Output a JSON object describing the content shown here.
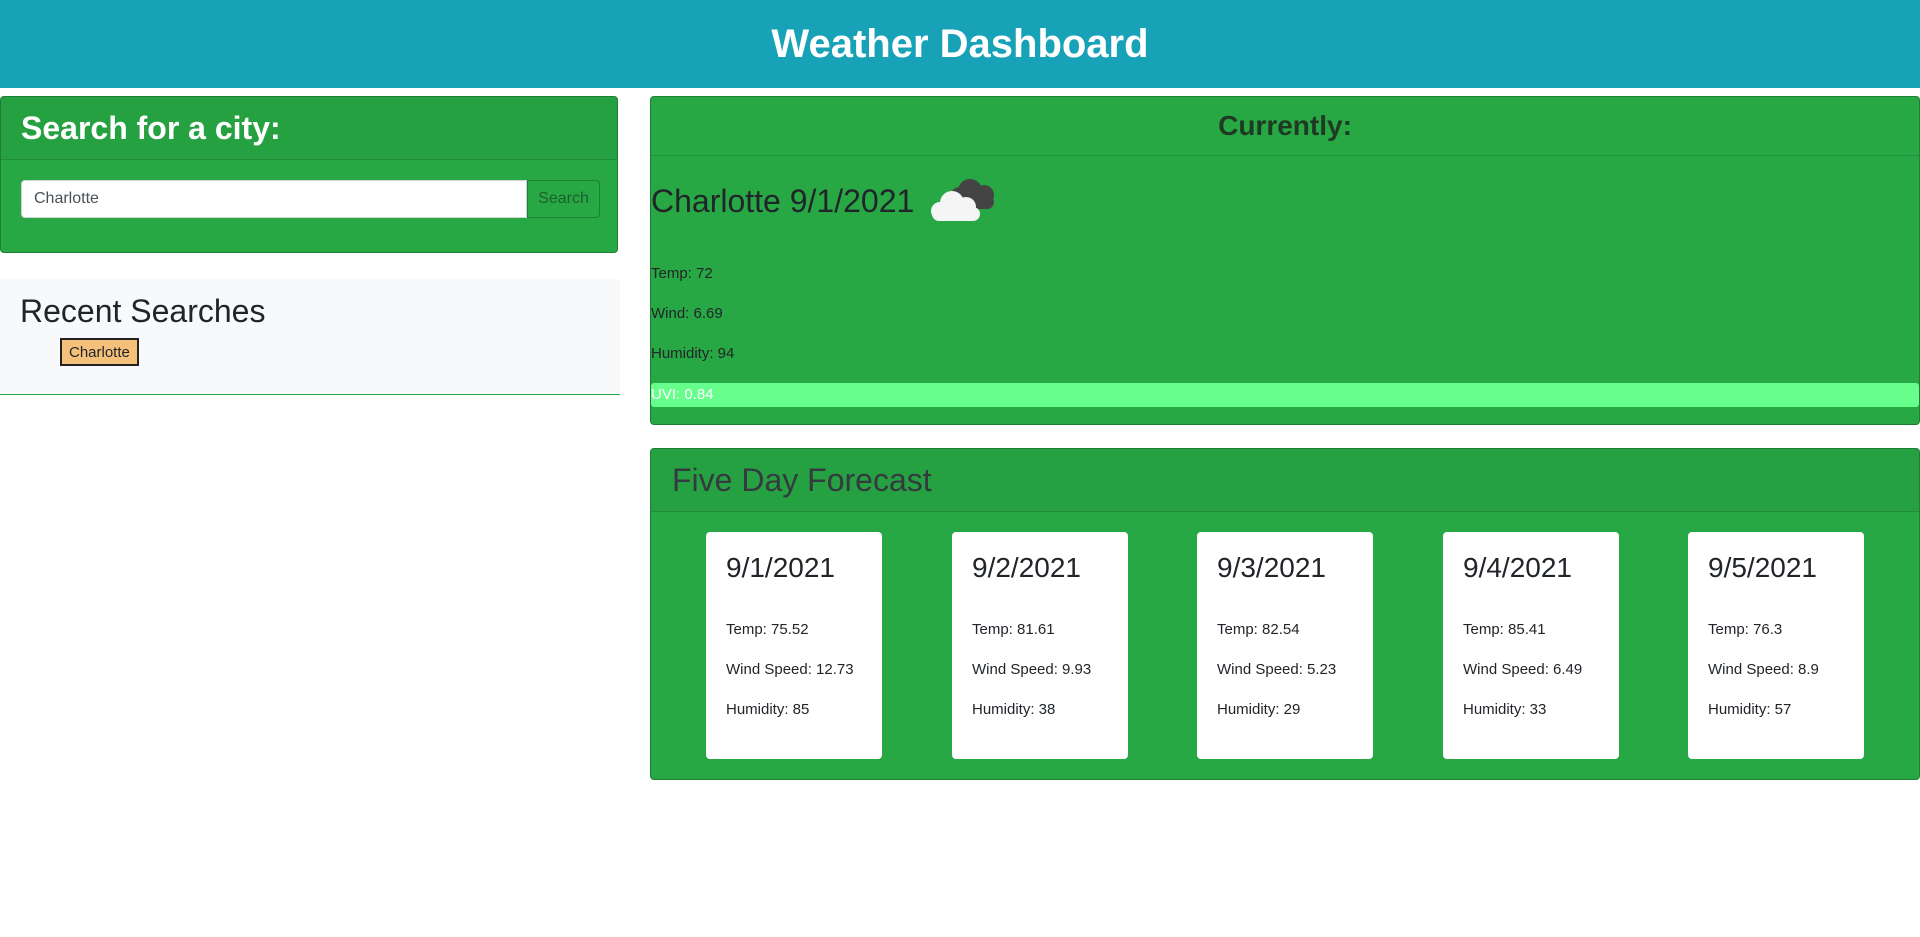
{
  "header": {
    "title": "Weather Dashboard"
  },
  "search": {
    "heading": "Search for a city:",
    "input_value": "Charlotte",
    "button_label": "Search"
  },
  "recent": {
    "heading": "Recent Searches",
    "items": [
      {
        "label": "Charlotte"
      }
    ]
  },
  "current": {
    "heading": "Currently:",
    "city_date": "Charlotte 9/1/2021",
    "icon": "cloud-icon",
    "temp": "Temp: 72",
    "wind": "Wind: 6.69",
    "humidity": "Humidity: 94",
    "uv": "UVI: 0.84",
    "uv_color": "#66ff8c"
  },
  "forecast": {
    "heading": "Five Day Forecast",
    "days": [
      {
        "date": "9/1/2021",
        "temp": "Temp: 75.52",
        "wind": "Wind Speed: 12.73",
        "humidity": "Humidity: 85"
      },
      {
        "date": "9/2/2021",
        "temp": "Temp: 81.61",
        "wind": "Wind Speed: 9.93",
        "humidity": "Humidity: 38"
      },
      {
        "date": "9/3/2021",
        "temp": "Temp: 82.54",
        "wind": "Wind Speed: 5.23",
        "humidity": "Humidity: 29"
      },
      {
        "date": "9/4/2021",
        "temp": "Temp: 85.41",
        "wind": "Wind Speed: 6.49",
        "humidity": "Humidity: 33"
      },
      {
        "date": "9/5/2021",
        "temp": "Temp: 76.3",
        "wind": "Wind Speed: 8.9",
        "humidity": "Humidity: 57"
      }
    ]
  },
  "colors": {
    "header_bg": "#17a2b8",
    "card_bg": "#28a745",
    "recent_button_bg": "#f5c07a"
  }
}
